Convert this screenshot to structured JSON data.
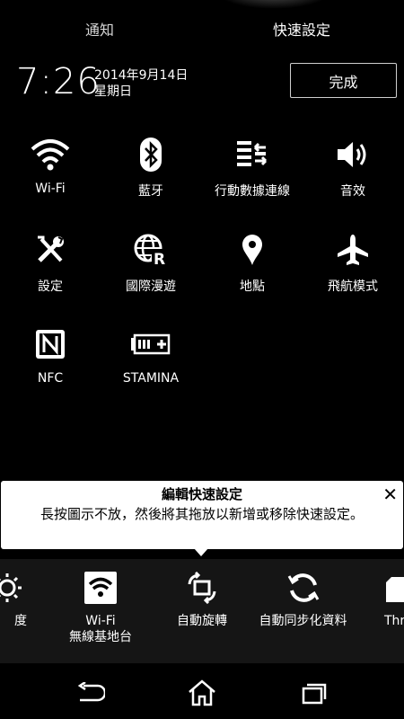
{
  "tabs": {
    "notifications": "通知",
    "quick_settings": "快速設定"
  },
  "status": {
    "time": "7:26",
    "date": "2014年9月14日",
    "weekday": "星期日"
  },
  "done_label": "完成",
  "tiles": [
    {
      "label": "Wi-Fi",
      "icon": "wifi-icon"
    },
    {
      "label": "藍牙",
      "icon": "bluetooth-icon"
    },
    {
      "label": "行動數據連線",
      "icon": "mobile-data-icon"
    },
    {
      "label": "音效",
      "icon": "volume-icon"
    },
    {
      "label": "設定",
      "icon": "settings-tools-icon"
    },
    {
      "label": "國際漫遊",
      "icon": "roaming-globe-icon"
    },
    {
      "label": "地點",
      "icon": "location-pin-icon"
    },
    {
      "label": "飛航模式",
      "icon": "airplane-icon"
    },
    {
      "label": "NFC",
      "icon": "nfc-icon"
    },
    {
      "label": "STAMINA",
      "icon": "stamina-battery-icon"
    }
  ],
  "tooltip": {
    "title": "編輯快速設定",
    "body": "長按圖示不放，然後將其拖放以新增或移除快速設定。",
    "close_icon": "close-icon"
  },
  "tray": [
    {
      "label": "度",
      "icon": "brightness-icon"
    },
    {
      "label": "Wi-Fi\n無線基地台",
      "label_line1": "Wi-Fi",
      "label_line2": "無線基地台",
      "icon": "wifi-hotspot-icon"
    },
    {
      "label": "自動旋轉",
      "icon": "auto-rotate-icon"
    },
    {
      "label": "自動同步化資料",
      "icon": "sync-icon"
    },
    {
      "label": "Thr",
      "icon": "throw-icon"
    }
  ],
  "nav": {
    "back_icon": "back-icon",
    "home_icon": "home-icon",
    "recents_icon": "recents-icon"
  }
}
